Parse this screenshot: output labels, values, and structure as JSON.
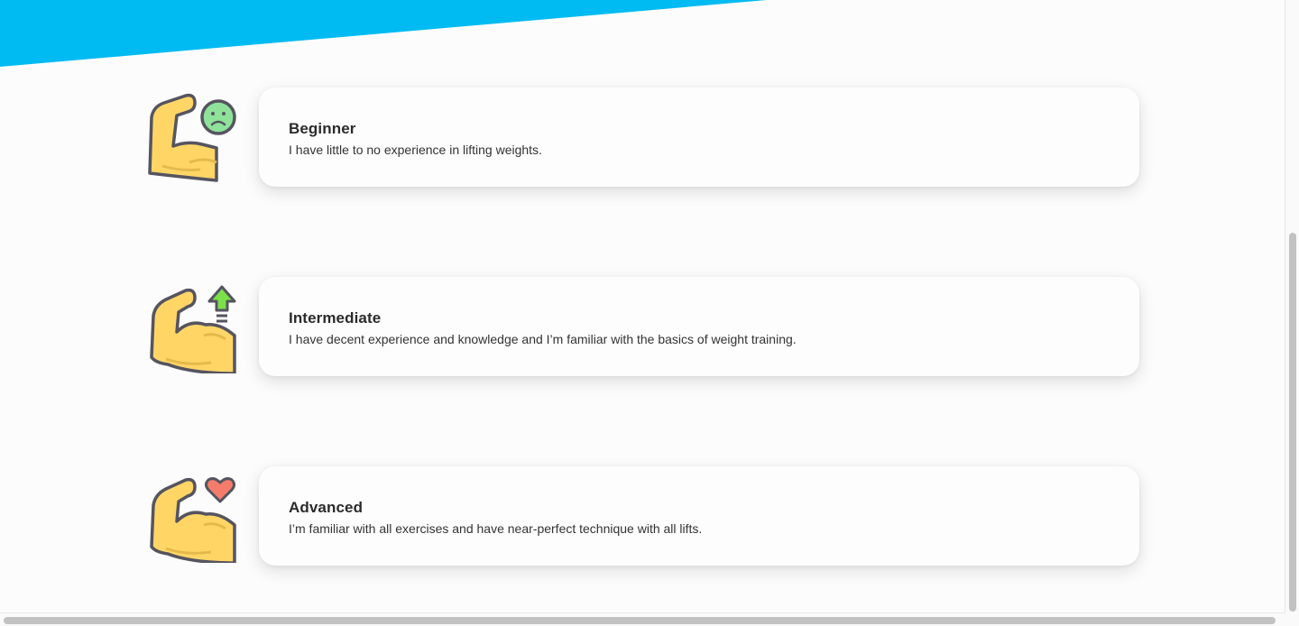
{
  "colors": {
    "banner": "#00bbf2",
    "arm_fill": "#ffd666",
    "arm_stroke": "#555460",
    "face_green": "#8ee29a",
    "arrow_green": "#7be04a",
    "heart_red": "#f37d6a"
  },
  "levels": [
    {
      "title": "Beginner",
      "description": "I have little to no experience in lifting weights.",
      "icon": "flexed-arm-sad-face-icon"
    },
    {
      "title": "Intermediate",
      "description": "I have decent experience and knowledge and I’m familiar with the basics of weight training.",
      "icon": "flexed-arm-up-arrow-icon"
    },
    {
      "title": "Advanced",
      "description": "I’m familiar with all exercises and have near-perfect technique with all lifts.",
      "icon": "flexed-arm-heart-icon"
    }
  ]
}
